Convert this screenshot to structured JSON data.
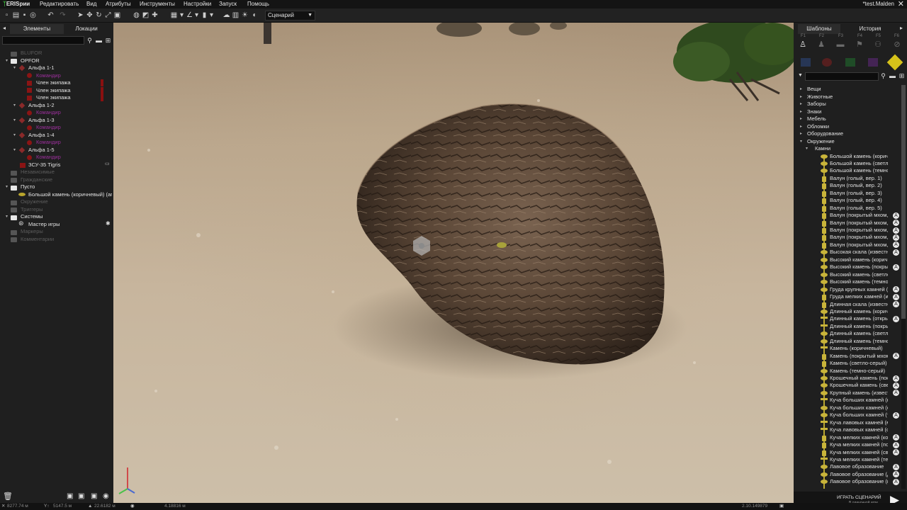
{
  "app": {
    "logo_prefix": "ᛉ",
    "logo_rest": "ERISрии",
    "mission_name": "*test.Malden"
  },
  "menu": [
    "Редактировать",
    "Вид",
    "Атрибуты",
    "Инструменты",
    "Настройки",
    "Запуск",
    "Помощь"
  ],
  "toolbar": {
    "mode_value": "Сценарий"
  },
  "left_panel": {
    "tabs": [
      "Элементы",
      "Локации"
    ],
    "tree": [
      {
        "label": "BLUFOR",
        "level": 0,
        "dim": true
      },
      {
        "label": "OPFOR",
        "level": 0,
        "dim": false
      },
      {
        "label": "Альфа 1-1",
        "level": 1
      },
      {
        "label": "Командир",
        "level": 2,
        "purple": true
      },
      {
        "label": "Член экипажа",
        "level": 2
      },
      {
        "label": "Член экипажа",
        "level": 2
      },
      {
        "label": "Член экипажа",
        "level": 2
      },
      {
        "label": "Альфа 1-2",
        "level": 1
      },
      {
        "label": "Командир",
        "level": 2,
        "purple": true
      },
      {
        "label": "Альфа 1-3",
        "level": 1
      },
      {
        "label": "Командир",
        "level": 2,
        "purple": true
      },
      {
        "label": "Альфа 1-4",
        "level": 1
      },
      {
        "label": "Командир",
        "level": 2,
        "purple": true
      },
      {
        "label": "Альфа 1-5",
        "level": 1
      },
      {
        "label": "Командир",
        "level": 2,
        "purple": true
      },
      {
        "label": "ЗСУ-35 Tigris",
        "level": 1
      },
      {
        "label": "Независимые",
        "level": 0,
        "dim": true
      },
      {
        "label": "Гражданские",
        "level": 0,
        "dim": true
      },
      {
        "label": "Пусто",
        "level": 0
      },
      {
        "label": "Большой камень (коричневый) (ars_S",
        "level": 1
      },
      {
        "label": "Окружение",
        "level": 0,
        "dim": true
      },
      {
        "label": "Триггеры",
        "level": 0,
        "dim": true
      },
      {
        "label": "Системы",
        "level": 0
      },
      {
        "label": "Мастер игры",
        "level": 1
      },
      {
        "label": "Маркеры",
        "level": 0,
        "dim": true
      },
      {
        "label": "Комментарии",
        "level": 0,
        "dim": true
      }
    ]
  },
  "right_panel": {
    "tabs": [
      "Шаблоны",
      "История"
    ],
    "fkeys": [
      "F1",
      "F2",
      "F3",
      "F4",
      "F5",
      "F6"
    ],
    "side_colors": [
      "#2f4e8c",
      "#8c1f1f",
      "#1f7a2f",
      "#6a2a8a",
      "#d6c21a"
    ],
    "categories": [
      "Вещи",
      "Животные",
      "Заборы",
      "Знаки",
      "Мебель",
      "Обломки",
      "Оборудование",
      "Окружение"
    ],
    "subcategory": "Камни",
    "assets": [
      "Большой камень (коричневый)",
      "Большой камень (светло-серый)",
      "Большой камень (темно-серый)",
      "Валун (голый, вер. 1)",
      "Валун (голый, вер. 2)",
      "Валун (голый, вер. 3)",
      "Валун (голый, вер. 4)",
      "Валун (голый, вер. 5)",
      "Валун (покрытый мхом, ве",
      "Валун (покрытый мхом, ве",
      "Валун (покрытый мхом, ве",
      "Валун (покрытый мхом, ве",
      "Валун (покрытый мхом, ве",
      "Высокая скала (известняк",
      "Высокий камень (коричневый)",
      "Высокий камень (покрыты",
      "Высокий камень (светло-серый)",
      "Высокий камень (темно-серый)",
      "Груда крупных камней (из",
      "Груда мелких камней (изв",
      "Длинная скала (известняк",
      "Длинный камень (коричневый)",
      "Длинный камень (открыты",
      "Длинный камень (покрыть",
      "Длинный камень (светло-серый)",
      "Длинный камень (темно-серый)",
      "Камень (коричневый)",
      "Камень (покрытый мхом)",
      "Камень (светло-серый)",
      "Камень (темно-серый)",
      "Крошечный камень (покры",
      "Крошечный камень (светло-сер",
      "Крупный камень (известня",
      "Куча больших камней (коричн",
      "Куча больших камней (светло-с",
      "Куча больших камней (темно-с",
      "Куча лавовых камней (маг",
      "Куча лавовых камней (оче",
      "Куча мелких камней (коричнев",
      "Куча мелких камней (покры",
      "Куча мелких камней (светло-сер",
      "Куча мелких камней (темно-серы",
      "Лавовое образование",
      "Лавовое образование (дли",
      "Лавовое образование (кор"
    ],
    "play_label": "ИГРАТЬ СЦЕНАРИЙ",
    "play_sub": "В одиночной игре"
  },
  "statusbar": {
    "x": "8277.74 м",
    "y": "5147.5 м",
    "z": "22.6182 м",
    "cam": "4.18816 м",
    "version": "2.10.149879"
  }
}
